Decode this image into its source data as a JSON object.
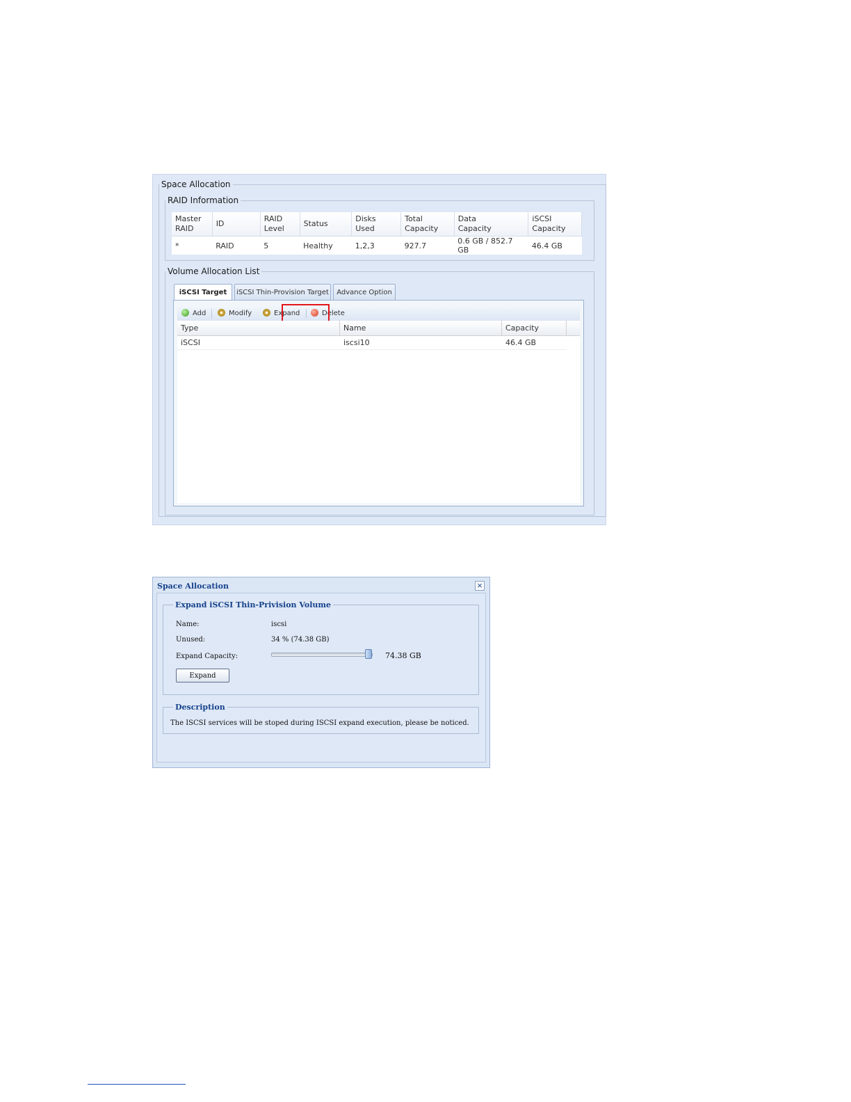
{
  "space_allocation_panel": {
    "title": "Space Allocation",
    "raid_information": {
      "title": "RAID Information",
      "columns": [
        "Master\nRAID",
        "ID",
        "RAID\nLevel",
        "Status",
        "Disks\nUsed",
        "Total\nCapacity",
        "Data\nCapacity",
        "iSCSI\nCapacity"
      ],
      "rows": [
        [
          "*",
          "RAID",
          "5",
          "Healthy",
          "1,2,3",
          "927.7",
          "0.6 GB / 852.7 GB",
          "46.4 GB"
        ]
      ]
    },
    "volume_allocation_list": {
      "title": "Volume Allocation List",
      "tabs": [
        "iSCSI Target",
        "iSCSI Thin-Provision Target",
        "Advance Option"
      ],
      "active_tab": "iSCSI Target",
      "toolbar": {
        "add_label": "Add",
        "modify_label": "Modify",
        "expand_label": "Expand",
        "delete_label": "Delete"
      },
      "grid": {
        "columns": [
          "Type",
          "Name",
          "Capacity"
        ],
        "rows": [
          [
            "iSCSI",
            "iscsi10",
            "46.4 GB"
          ]
        ]
      }
    }
  },
  "expand_dialog": {
    "title": "Space Allocation",
    "close_symbol": "×",
    "section_title": "Expand iSCSI Thin-Privision Volume",
    "name_label": "Name:",
    "name_value": "iscsi",
    "unused_label": "Unused:",
    "unused_value": "34 % (74.38 GB)",
    "expand_capacity_label": "Expand Capacity:",
    "expand_capacity_value": "74.38 GB",
    "slider_fraction": 1.0,
    "expand_button_label": "Expand",
    "description_title": "Description",
    "description_text": "The ISCSI services will be stoped during ISCSI expand execution, please be noticed."
  },
  "colors": {
    "highlight_border": "#e2151b",
    "panel_background": "#dfe8f6",
    "dialog_title": "#15428b"
  }
}
